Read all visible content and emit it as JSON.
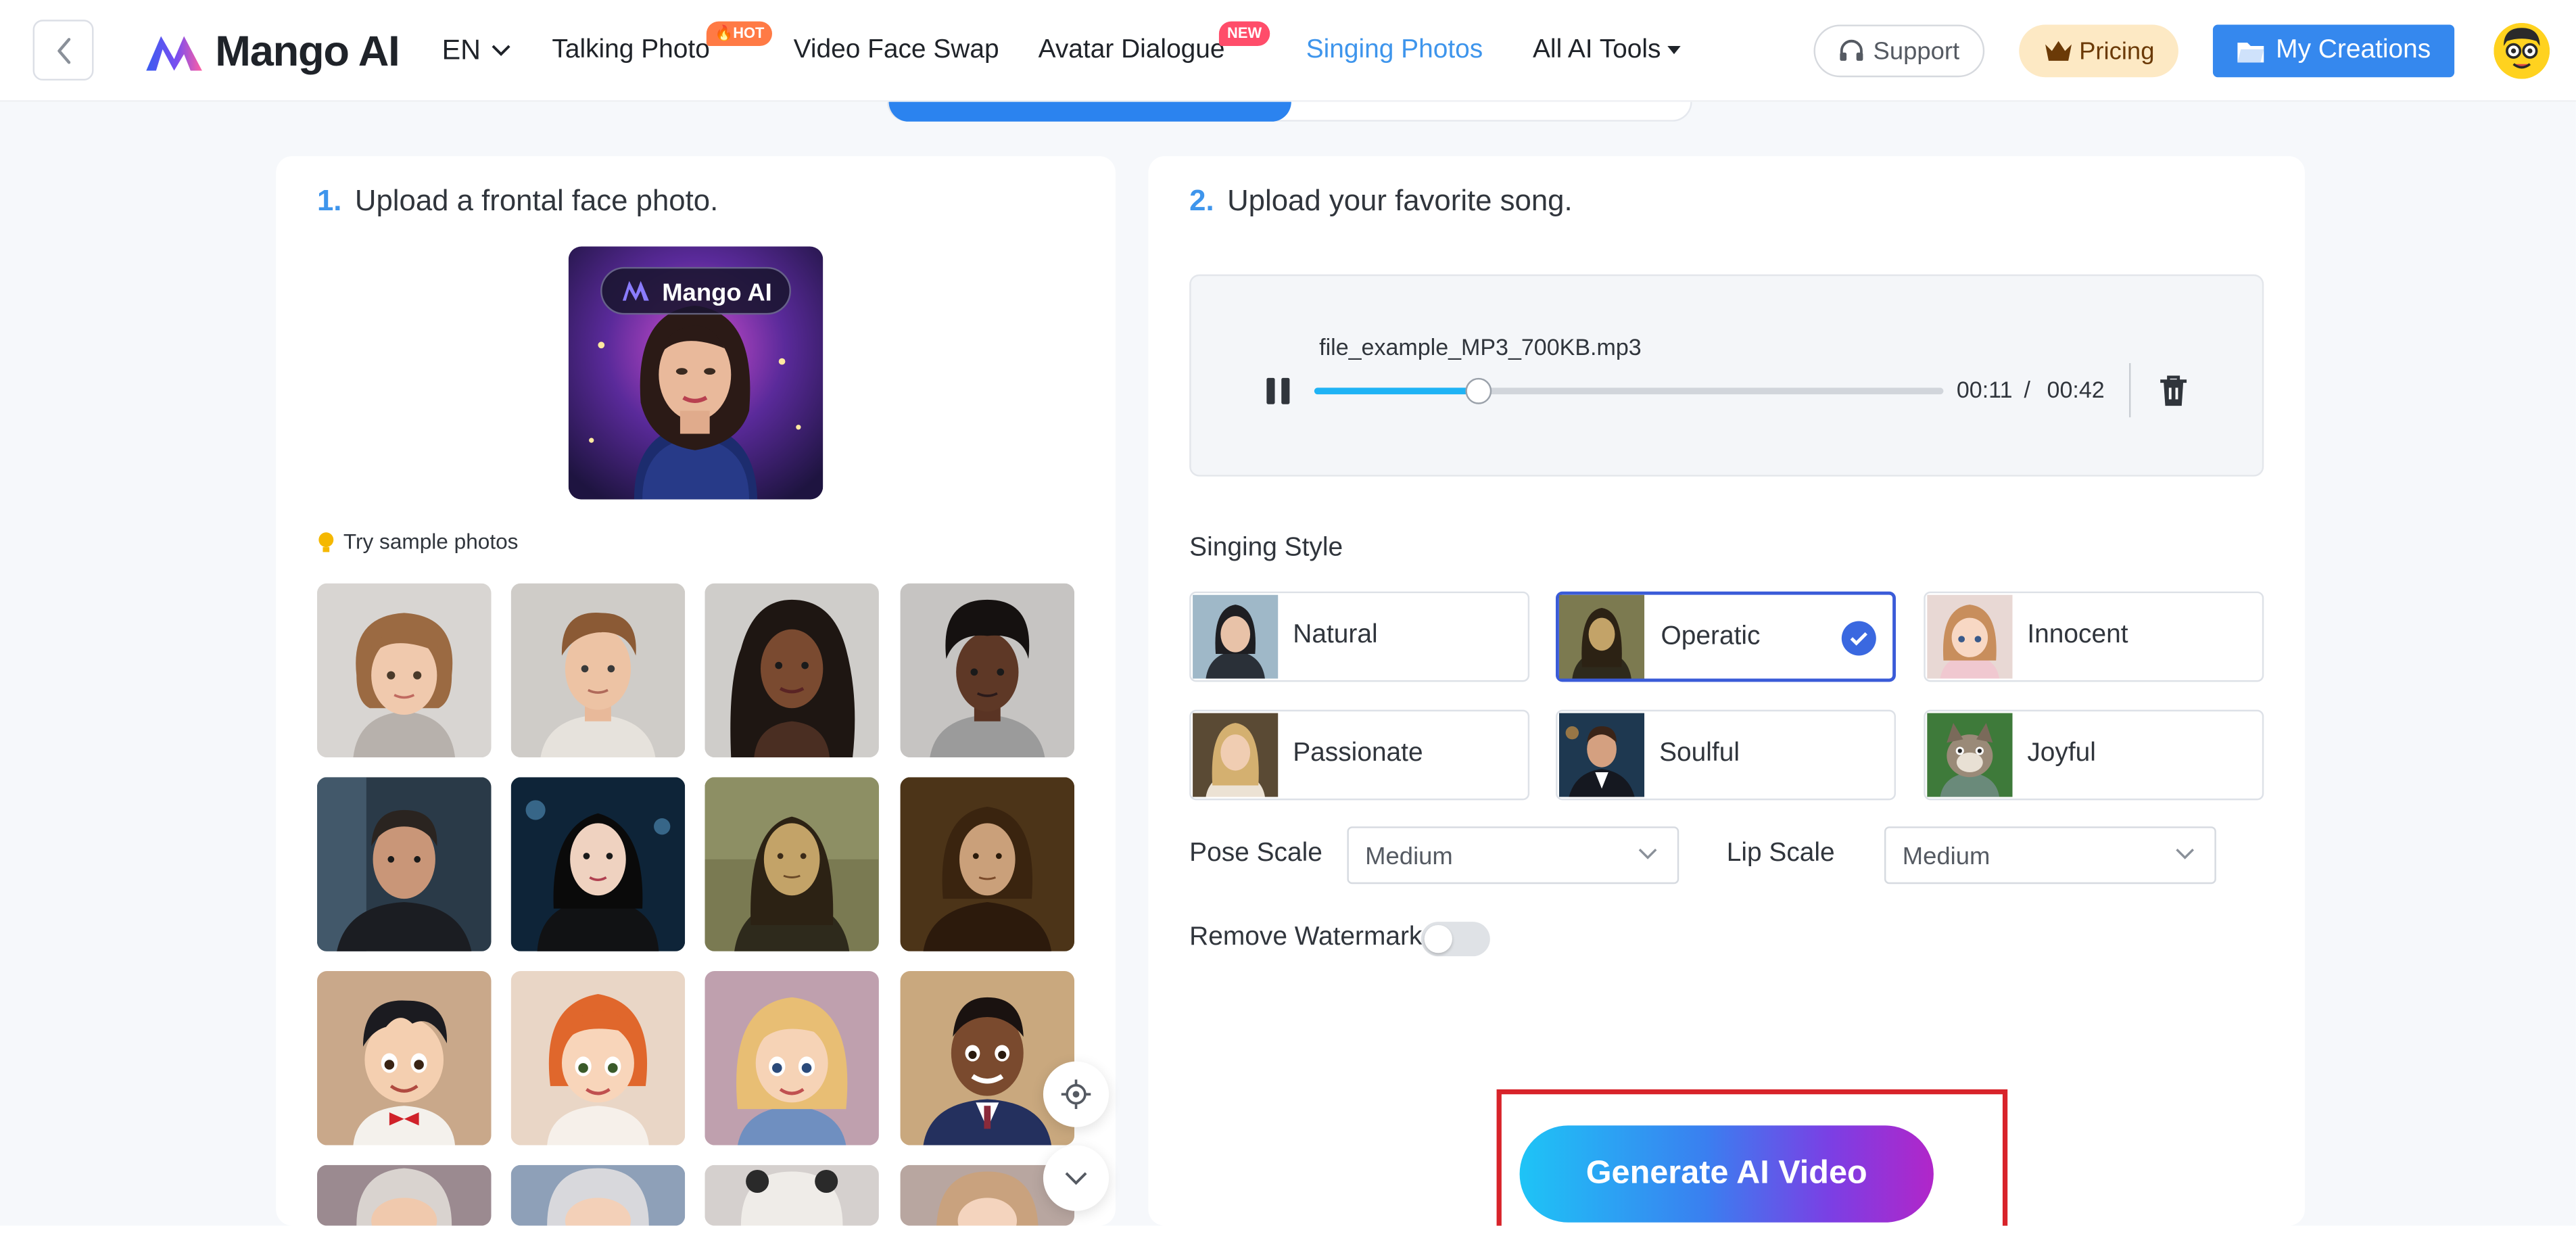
{
  "header": {
    "brand": "Mango AI",
    "language": "EN",
    "nav": [
      {
        "label": "Talking Photo",
        "badge": "HOT"
      },
      {
        "label": "Video Face Swap",
        "badge": ""
      },
      {
        "label": "Avatar Dialogue",
        "badge": "NEW"
      },
      {
        "label": "Singing Photos",
        "badge": "",
        "active": true
      },
      {
        "label": "All AI Tools",
        "badge": ""
      }
    ],
    "support_label": "Support",
    "pricing_label": "Pricing",
    "creations_label": "My Creations"
  },
  "left_panel": {
    "step_number": "1.",
    "step_title": "Upload a frontal face photo.",
    "preview_watermark": "Mango AI",
    "try_samples_label": "Try sample photos",
    "samples": [
      "girl-short-hair",
      "young-man",
      "woman-curly-hair",
      "young-man-curly-hair",
      "man-suit",
      "asian-woman-leather-jacket",
      "mona-lisa",
      "classical-portrait-man",
      "cartoon-boy-bowtie",
      "cartoon-girl-red-hair",
      "cartoon-girl-blonde",
      "cartoon-man-suit",
      "cartoon-grandpa",
      "cartoon-grandma",
      "cartoon-panda-hat",
      "cartoon-woman"
    ]
  },
  "right_panel": {
    "step_number": "2.",
    "step_title": "Upload your favorite song.",
    "audio": {
      "file_name": "file_example_MP3_700KB.mp3",
      "current_time": "00:11",
      "separator": "/",
      "duration": "00:42",
      "progress": 0.262
    },
    "singing_style_label": "Singing Style",
    "styles": [
      {
        "name": "Natural",
        "selected": false
      },
      {
        "name": "Operatic",
        "selected": true
      },
      {
        "name": "Innocent",
        "selected": false
      },
      {
        "name": "Passionate",
        "selected": false
      },
      {
        "name": "Soulful",
        "selected": false
      },
      {
        "name": "Joyful",
        "selected": false
      }
    ],
    "pose_scale_label": "Pose Scale",
    "pose_scale_value": "Medium",
    "lip_scale_label": "Lip Scale",
    "lip_scale_value": "Medium",
    "remove_watermark_label": "Remove Watermark",
    "remove_watermark_on": false,
    "generate_label": "Generate AI Video"
  },
  "colors": {
    "accent_blue": "#3e95ec",
    "primary_button": "#3588ee",
    "selected_border": "#3a5bd8",
    "highlight_outline": "#d8232a"
  },
  "icons": [
    "chevron-left-icon",
    "mango-logo-icon",
    "chevron-down-icon",
    "fire-icon",
    "headset-icon",
    "crown-icon",
    "folder-icon",
    "lightbulb-icon",
    "pause-icon",
    "trash-icon",
    "check-icon",
    "locate-icon"
  ]
}
